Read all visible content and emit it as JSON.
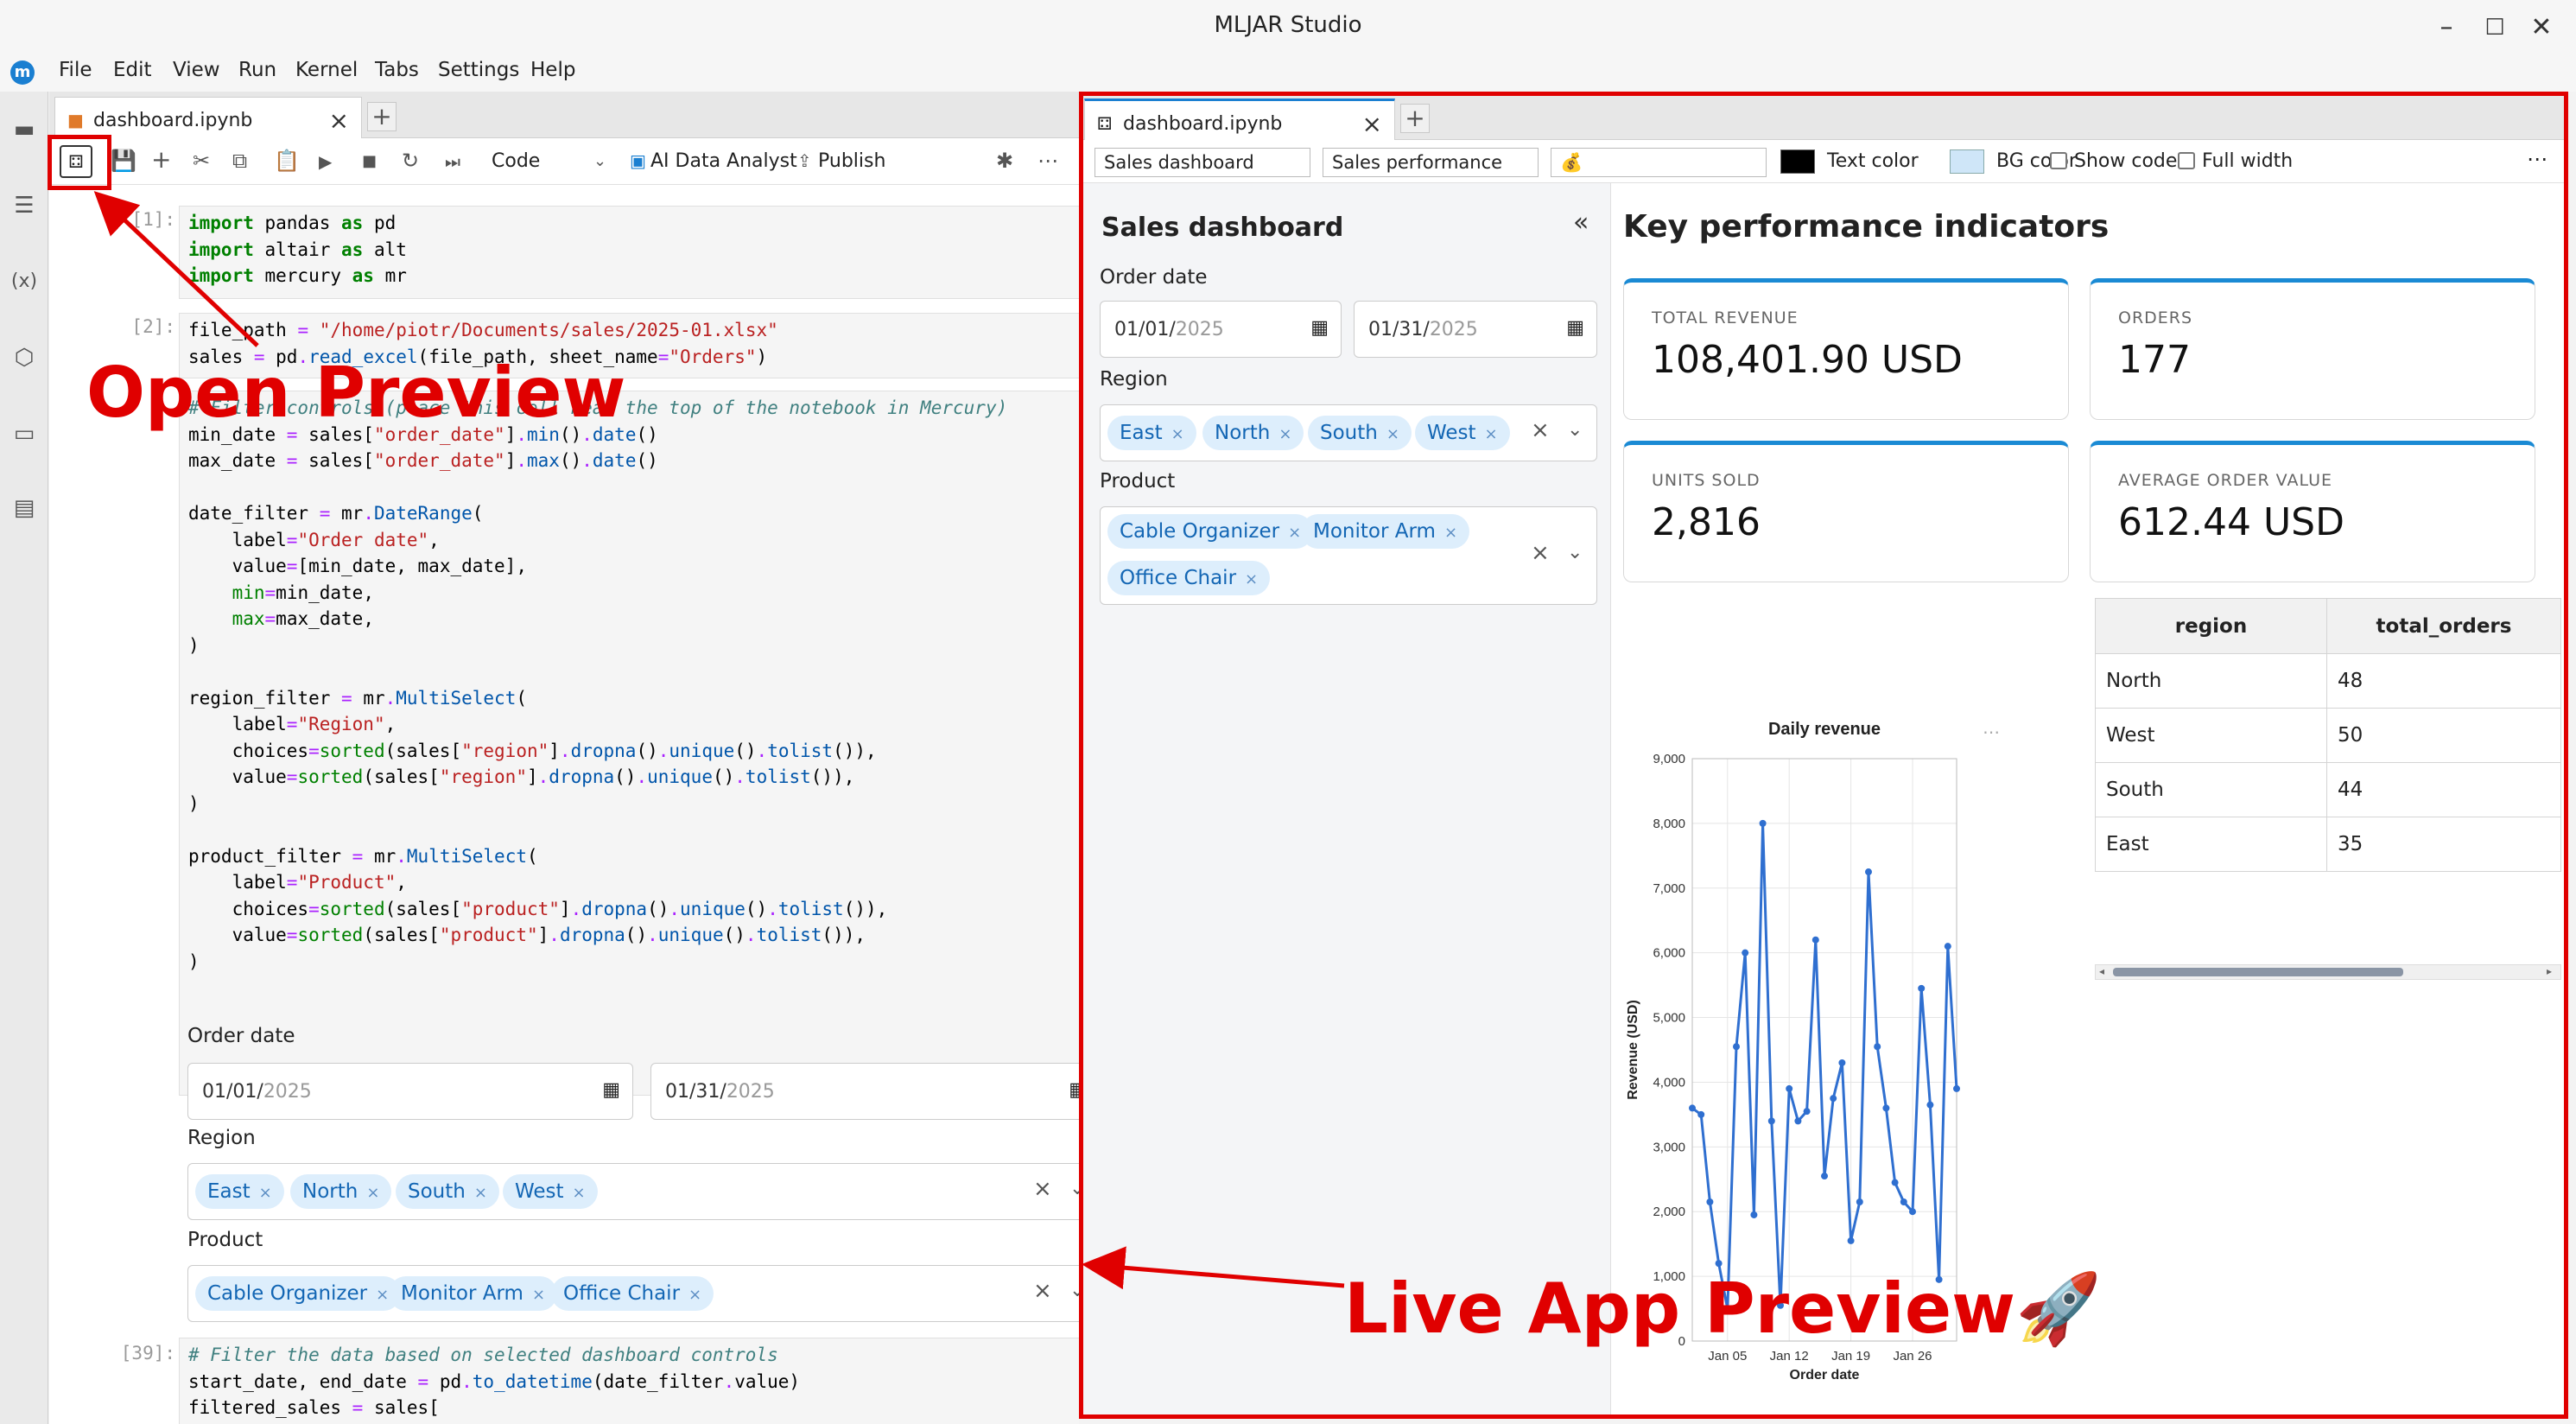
{
  "app": {
    "title": "MLJAR Studio",
    "logo": "m"
  },
  "menu": [
    "File",
    "Edit",
    "View",
    "Run",
    "Kernel",
    "Tabs",
    "Settings",
    "Help"
  ],
  "left": {
    "tab_label": "dashboard.ipynb",
    "toolbar": {
      "cell_type": "Code",
      "ai_label": "AI Data Analyst",
      "publish_label": "Publish"
    },
    "prompts": {
      "p1": "[1]:",
      "p2": "[2]:",
      "p39": "[39]:"
    },
    "code1": [
      "import pandas as pd",
      "import altair as alt",
      "import mercury as mr"
    ],
    "code2": [
      "file_path = \"/home/piotr/Documents/sales/2025-01.xlsx\"",
      "sales = pd.read_excel(file_path, sheet_name=\"Orders\")"
    ],
    "code3_comment": "# Filter controls (place this cell near the top of the notebook in Mercury)",
    "code4": [
      "# Filter the data based on selected dashboard controls",
      "start_date, end_date = pd.to_datetime(date_filter.value)",
      "filtered_sales = sales["
    ]
  },
  "widgets": {
    "order_date_label": "Order date",
    "date_start": {
      "mm": "01/",
      "dd": "01/",
      "yyyy": "2025"
    },
    "date_end": {
      "mm": "01/",
      "dd": "31/",
      "yyyy": "2025"
    },
    "region_label": "Region",
    "regions": [
      "East",
      "North",
      "South",
      "West"
    ],
    "product_label": "Product",
    "products": [
      "Cable Organizer",
      "Monitor Arm",
      "Office Chair"
    ]
  },
  "preview": {
    "tab_label": "dashboard.ipynb",
    "title_input": "Sales dashboard",
    "desc_input": "Sales performance",
    "icon_input": "💰",
    "text_color_label": "Text color",
    "bg_color_label": "BG color",
    "show_code_label": "Show code",
    "full_width_label": "Full width",
    "sidebar_title": "Sales dashboard",
    "kpi_heading": "Key performance indicators",
    "kpis": [
      {
        "label": "TOTAL REVENUE",
        "value": "108,401.90 USD"
      },
      {
        "label": "ORDERS",
        "value": "177"
      },
      {
        "label": "UNITS SOLD",
        "value": "2,816"
      },
      {
        "label": "AVERAGE ORDER VALUE",
        "value": "612.44 USD"
      }
    ],
    "table": {
      "headers": [
        "region",
        "total_orders"
      ],
      "rows": [
        [
          "North",
          "48"
        ],
        [
          "West",
          "50"
        ],
        [
          "South",
          "44"
        ],
        [
          "East",
          "35"
        ]
      ]
    }
  },
  "colors": {
    "accent": "#1a8ad4",
    "annotation": "#e00000",
    "text_color_swatch": "#000000",
    "bg_color_swatch": "#cfe6f8",
    "line": "#2f6fd0"
  },
  "annotations": {
    "open_preview": "Open Preview",
    "live_preview": "Live App Preview🚀"
  },
  "chart_data": {
    "type": "line",
    "title": "Daily revenue",
    "xlabel": "Order date",
    "ylabel": "Revenue (USD)",
    "ylim": [
      0,
      9000
    ],
    "yticks": [
      "0",
      "1,000",
      "2,000",
      "3,000",
      "4,000",
      "5,000",
      "6,000",
      "7,000",
      "8,000",
      "9,000"
    ],
    "xticks": [
      {
        "label": "Jan 05",
        "day": 5
      },
      {
        "label": "Jan 12",
        "day": 12
      },
      {
        "label": "Jan 19",
        "day": 19
      },
      {
        "label": "Jan 26",
        "day": 26
      }
    ],
    "x": [
      1,
      2,
      3,
      4,
      5,
      6,
      7,
      8,
      9,
      10,
      11,
      12,
      13,
      14,
      15,
      16,
      17,
      18,
      19,
      20,
      21,
      22,
      23,
      24,
      25,
      26,
      27,
      28,
      29,
      30,
      31
    ],
    "values": [
      3600,
      3500,
      2150,
      1200,
      500,
      4550,
      6000,
      1950,
      8000,
      3400,
      550,
      3900,
      3400,
      3550,
      6200,
      2550,
      3750,
      4300,
      1550,
      2150,
      7250,
      4550,
      3600,
      2450,
      2150,
      2000,
      5450,
      3650,
      950,
      6100,
      3900
    ],
    "grid": true
  }
}
